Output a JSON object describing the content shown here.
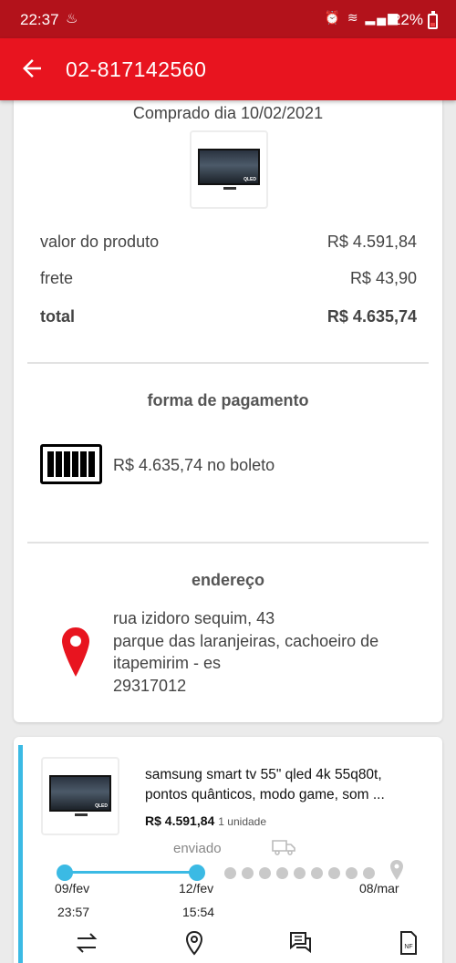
{
  "status_bar": {
    "time": "22:37",
    "battery": "22%"
  },
  "app_bar": {
    "title": "02-817142560"
  },
  "order": {
    "purchased": "Comprado dia 10/02/2021",
    "rows": [
      {
        "label": "valor do produto",
        "value": "R$ 4.591,84"
      },
      {
        "label": "frete",
        "value": "R$ 43,90"
      },
      {
        "label": "total",
        "value": "R$ 4.635,74"
      }
    ]
  },
  "payment": {
    "title": "forma de pagamento",
    "text": "R$ 4.635,74 no boleto"
  },
  "address": {
    "title": "endereço",
    "line1": "rua izidoro sequim, 43",
    "line2": "parque das laranjeiras, cachoeiro de",
    "line3": "itapemirim - es",
    "line4": "29317012"
  },
  "product": {
    "tv_logo": "QLED",
    "name_line1": "samsung smart tv 55\" qled 4k 55q80t,",
    "name_line2": "pontos quânticos, modo game, som ...",
    "price": "R$ 4.591,84",
    "qty": "1 unidade"
  },
  "tracking": {
    "status": "enviado",
    "step1_date": "09/fev",
    "step1_time": "23:57",
    "step2_date": "12/fev",
    "step2_time": "15:54",
    "step3_date": "08/mar"
  },
  "colors": {
    "header": "#e8141f",
    "status_bar": "#b3121b",
    "accent": "#3bbae4",
    "pin": "#e8141f"
  },
  "icons": [
    "back-arrow-icon",
    "barcode-icon",
    "location-pin-icon",
    "truck-icon",
    "exchange-icon",
    "chat-icon",
    "invoice-icon"
  ]
}
